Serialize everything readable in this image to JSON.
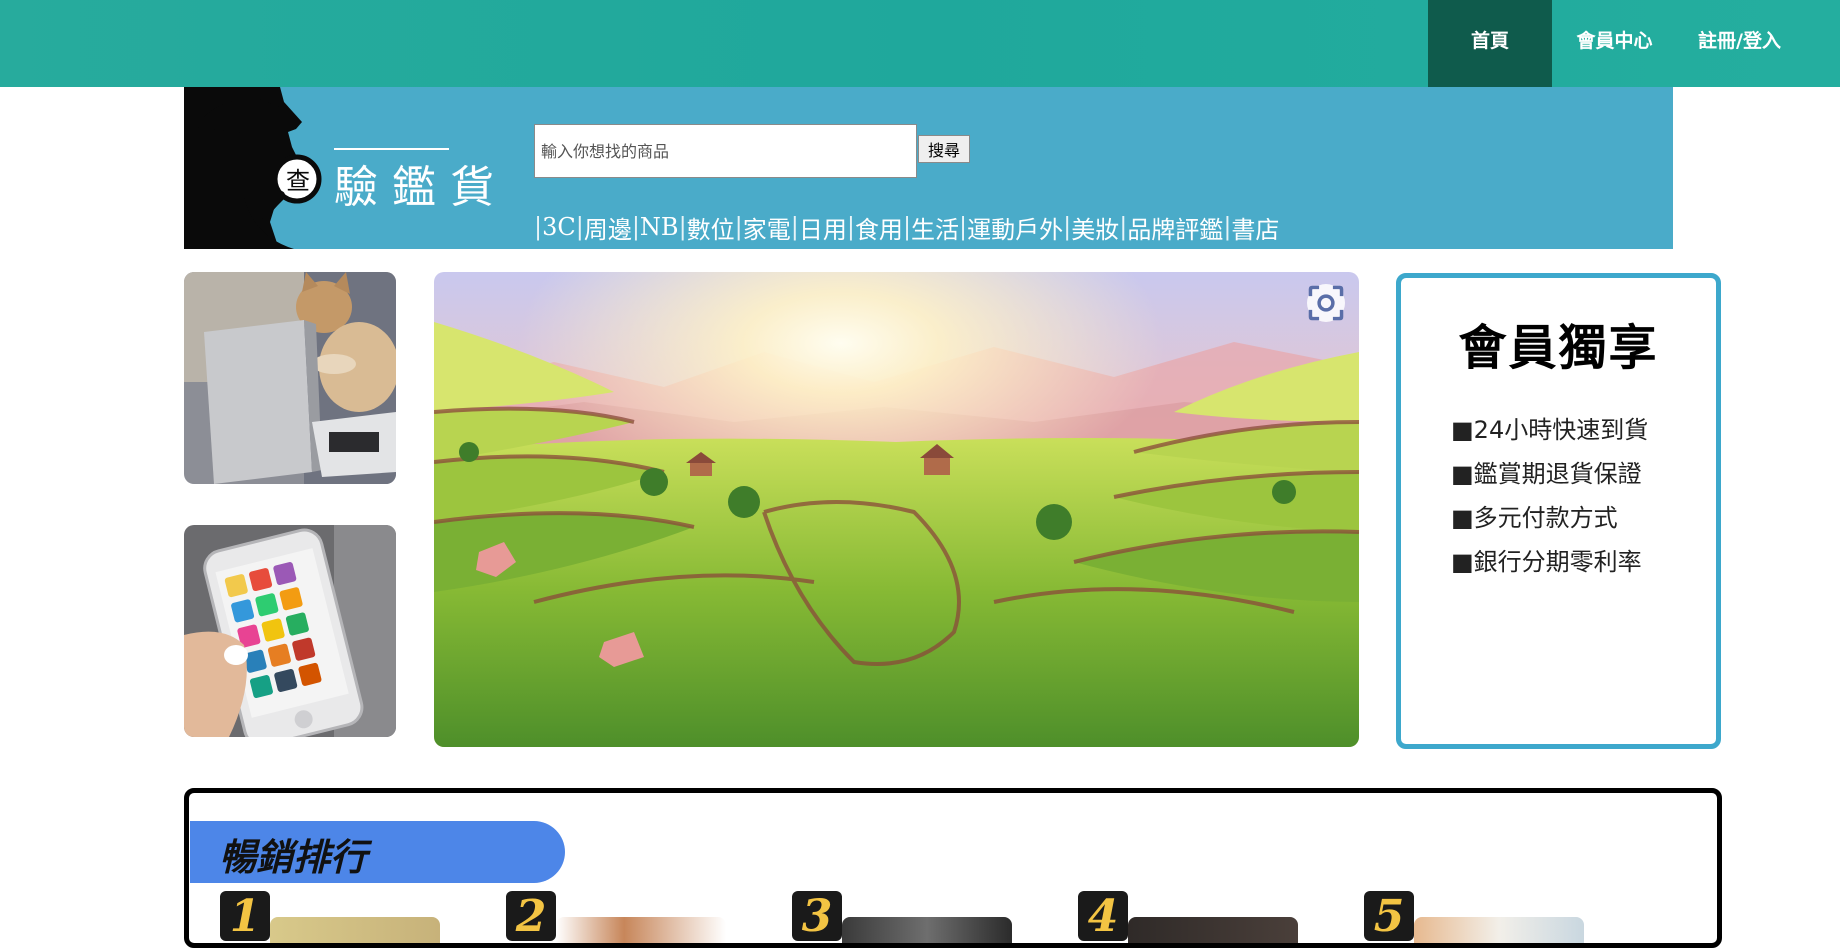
{
  "topnav": {
    "home": "首頁",
    "member_center": "會員中心",
    "register_login": "註冊/登入"
  },
  "banner": {
    "logo_text": "驗鑑貨"
  },
  "search": {
    "placeholder": "輸入你想找的商品",
    "value": "",
    "button": "搜尋"
  },
  "categories": [
    "3C",
    "周邊",
    "NB",
    "數位",
    "家電",
    "日用",
    "食用",
    "生活",
    "運動戶外",
    "美妝",
    "品牌評鑑",
    "書店"
  ],
  "member_panel": {
    "title": "會員獨享",
    "perks": [
      "■24小時快速到貨",
      "■鑑賞期退貨保證",
      "■多元付款方式",
      "■銀行分期零利率"
    ]
  },
  "ranking": {
    "title": "暢銷排行",
    "ranks": [
      "1",
      "2",
      "3",
      "4",
      "5"
    ]
  },
  "colors": {
    "topbar": "#24ab9d",
    "topbar_active": "#0f5b4c",
    "banner": "#4aabc9",
    "panel_border": "#3da8cc",
    "rank_tab": "#4d86e8",
    "rank_num": "#f3c443"
  },
  "icons": {
    "visual_search": "lens-icon"
  }
}
